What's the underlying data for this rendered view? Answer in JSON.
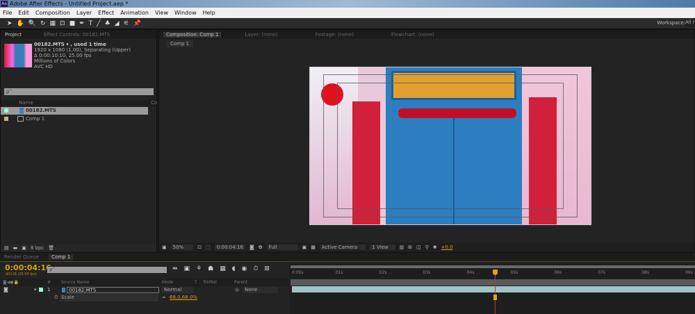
{
  "window": {
    "title": "Adobe After Effects - Untitled Project.aep *",
    "logo": "Ae"
  },
  "menu": [
    "File",
    "Edit",
    "Composition",
    "Layer",
    "Effect",
    "Animation",
    "View",
    "Window",
    "Help"
  ],
  "toolbar": {
    "icons": [
      "selection-icon",
      "hand-icon",
      "zoom-icon",
      "rotate-icon",
      "camera-icon",
      "pan-behind-icon",
      "rectangle-icon",
      "pen-icon",
      "text-icon",
      "brush-icon",
      "clone-stamp-icon",
      "eraser-icon",
      "roto-brush-icon",
      "puppet-pin-icon"
    ],
    "text_glyph": "T",
    "workspace_label": "Workspace:",
    "workspace_value": "All I"
  },
  "project": {
    "tabs": [
      "Project",
      "Effect Controls: 00182.MTS"
    ],
    "item_name": "00182.MTS ▾ , used 1 time",
    "info": [
      "1920 x 1080 (1.00), Separating (Upper)",
      "Δ 0:00:10:10, 25.00 fps",
      "Millions of Colors",
      "AVC HD"
    ],
    "search_placeholder": "ρ˜",
    "col_name": "Name",
    "col_other": "Co",
    "items": [
      {
        "name": "00182.MTS",
        "type": "footage",
        "selected": true
      },
      {
        "name": "Comp 1",
        "type": "composition"
      }
    ],
    "footer_bpc": "8 bpc"
  },
  "viewer": {
    "tabs": [
      "Composition: Comp 1",
      "Layer: (none)",
      "Footage: (none)",
      "Flowchart: (none)"
    ],
    "breadcrumb": "Comp 1",
    "zoom": "50%",
    "timecode": "0:00:04:16",
    "resolution": "Full",
    "camera": "Active Camera",
    "views": "1 View",
    "exposure": "+0.0"
  },
  "timeline": {
    "tabs": [
      "Render Queue",
      "Comp 1"
    ],
    "current_time": "0:00:04:16",
    "frame_info": "00116 (25.00 fps)",
    "search_placeholder": "ρ˜",
    "columns": {
      "num": "#",
      "source": "Source Name",
      "mode": "Mode",
      "t": "T",
      "trkmat": "TrkMat",
      "parent": "Parent"
    },
    "layer": {
      "index": "1",
      "name": "00182.MTS",
      "mode": "Normal",
      "parent": "None"
    },
    "property": {
      "name": "Scale",
      "value": "68.0,68.0%"
    },
    "ruler": [
      "0:00s",
      "01s",
      "02s",
      "03s",
      "04s",
      "05s",
      "06s",
      "07s",
      "08s",
      "09s"
    ],
    "current_time_seconds": 4.64
  },
  "colors": {
    "accent_time": "#d4a017",
    "layer_bar": "#9fc4c4",
    "cti": "#c0392b"
  }
}
